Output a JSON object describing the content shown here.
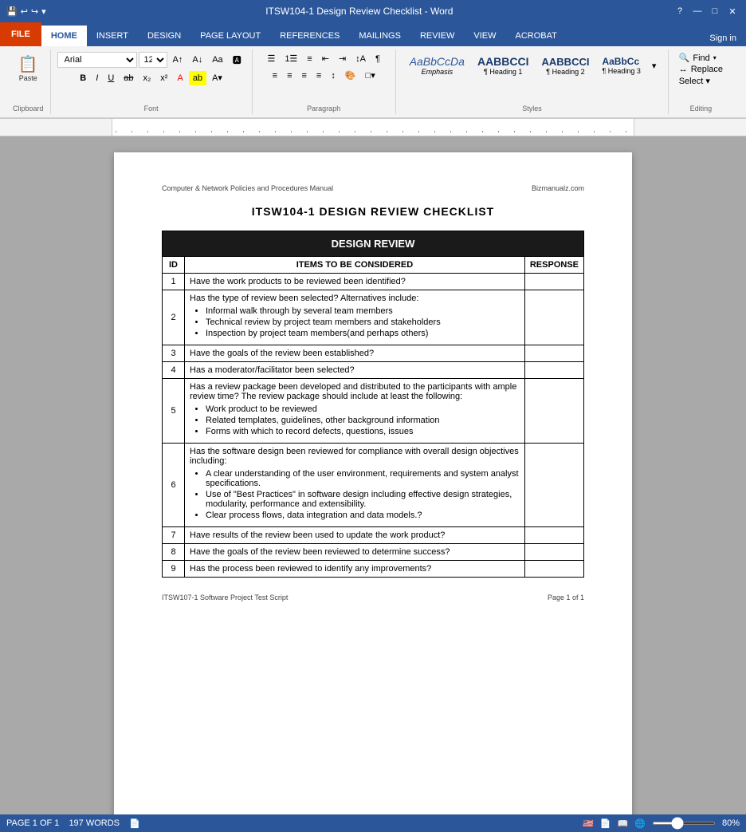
{
  "window": {
    "title": "ITSW104-1 Design Review Checklist - Word",
    "controls": [
      "?",
      "—",
      "□",
      "✕"
    ]
  },
  "quick_access": {
    "items": [
      "💾",
      "↩",
      "↪",
      "▾"
    ]
  },
  "file_tab": "FILE",
  "ribbon": {
    "tabs": [
      "HOME",
      "INSERT",
      "DESIGN",
      "PAGE LAYOUT",
      "REFERENCES",
      "MAILINGS",
      "REVIEW",
      "VIEW",
      "ACROBAT"
    ],
    "active_tab": "HOME"
  },
  "sign_in": "Sign in",
  "toolbar": {
    "paste_label": "Paste",
    "clipboard_label": "Clipboard",
    "font_name": "Arial",
    "font_size": "12",
    "font_label": "Font",
    "paragraph_label": "Paragraph",
    "styles_label": "Styles",
    "editing_label": "Editing",
    "bold": "B",
    "italic": "I",
    "underline": "U",
    "styles": [
      {
        "name": "Emphasis",
        "preview": "AaBbCcDa",
        "style": "italic"
      },
      {
        "name": "Heading 1",
        "preview": "AABBCCI",
        "style": "bold"
      },
      {
        "name": "Heading 2",
        "preview": "AABBCCI",
        "style": "bold"
      },
      {
        "name": "Heading 3",
        "preview": "AaBbCc",
        "style": "bold"
      }
    ],
    "find_label": "Find",
    "replace_label": "Replace",
    "select_label": "Select ▾"
  },
  "page": {
    "header_left": "Computer & Network Policies and Procedures Manual",
    "header_right": "Bizmanualz.com",
    "title": "ITSW104-1   DESIGN REVIEW CHECKLIST",
    "table": {
      "main_header": "DESIGN REVIEW",
      "col_id": "ID",
      "col_items": "ITEMS TO BE CONSIDERED",
      "col_response": "RESPONSE",
      "rows": [
        {
          "id": "1",
          "item": "Have the work products to be reviewed been identified?",
          "bullets": []
        },
        {
          "id": "2",
          "item": "Has the type of review been selected? Alternatives include:",
          "bullets": [
            "Informal walk through by several team members",
            "Technical review by project team members and stakeholders",
            "Inspection by project team members(and perhaps others)"
          ]
        },
        {
          "id": "3",
          "item": "Have the goals of the review been established?",
          "bullets": []
        },
        {
          "id": "4",
          "item": "Has a moderator/facilitator been selected?",
          "bullets": []
        },
        {
          "id": "5",
          "item": "Has a review package been developed and distributed to the participants with ample review time? The review package should include at least the following:",
          "bullets": [
            "Work product to be reviewed",
            "Related templates, guidelines, other background information",
            "Forms with which to record defects, questions, issues"
          ]
        },
        {
          "id": "6",
          "item": "Has the software design been reviewed for compliance with overall design objectives including:",
          "bullets": [
            "A clear understanding of the user environment, requirements and system analyst specifications.",
            "Use of \"Best Practices\" in software design including effective design strategies, modularity, performance and extensibility.",
            "Clear process flows, data integration and data models.?"
          ]
        },
        {
          "id": "7",
          "item": "Have results of the review been used to update the work product?",
          "bullets": []
        },
        {
          "id": "8",
          "item": "Have the goals of the review been reviewed to determine success?",
          "bullets": []
        },
        {
          "id": "9",
          "item": "Has the process been reviewed to identify any improvements?",
          "bullets": []
        }
      ]
    },
    "footer_left": "ITSW107-1 Software Project Test Script",
    "footer_right": "Page 1 of 1"
  },
  "status_bar": {
    "page_info": "PAGE 1 OF 1",
    "word_count": "197 WORDS",
    "zoom": "80%",
    "zoom_value": 80
  }
}
